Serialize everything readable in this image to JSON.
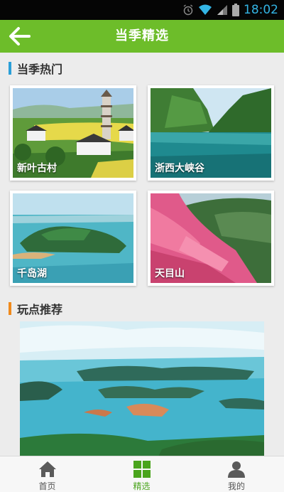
{
  "status_bar": {
    "time": "18:02",
    "icons": [
      "alarm-icon",
      "wifi-icon",
      "signal-icon",
      "battery-icon"
    ]
  },
  "app_bar": {
    "title": "当季精选",
    "back_icon": "arrow-left-icon"
  },
  "sections": {
    "hot": {
      "title": "当季热门",
      "accent": "#2a9fd8"
    },
    "recommend": {
      "title": "玩点推荐",
      "accent": "#f08a1c"
    }
  },
  "cards": [
    {
      "label": "新叶古村"
    },
    {
      "label": "浙西大峡谷"
    },
    {
      "label": "千岛湖"
    },
    {
      "label": "天目山"
    }
  ],
  "tabs": [
    {
      "label": "首页",
      "icon": "home-icon"
    },
    {
      "label": "精选",
      "icon": "grid-icon"
    },
    {
      "label": "我的",
      "icon": "user-icon"
    }
  ],
  "colors": {
    "brand": "#6dbd2a",
    "active_tab": "#4aa41c"
  }
}
